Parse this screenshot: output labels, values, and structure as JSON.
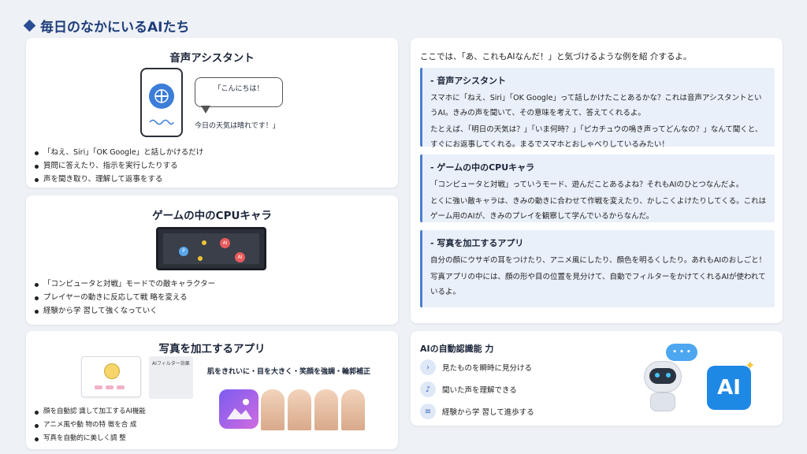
{
  "page": {
    "title": "毎日のなかにいるAIたち"
  },
  "voice_card": {
    "title": "音声アシスタント",
    "bubble_line1": "「こんにちは！",
    "bubble_line2": "今日の天気は晴れです！」",
    "bullets": [
      "「ねえ、Siri」「OK Google」と話しかけるだけ",
      "質問に答えたり、指示を実行したりする",
      "声を聞き取り、理解して返事をする"
    ]
  },
  "game_card": {
    "title": "ゲームの中のCPUキャラ",
    "screen_p": "P",
    "screen_ai1": "AI",
    "screen_ai2": "AI",
    "bullets": [
      "「コンピュータと対戦」モードでの敵キャラクター",
      "プレイヤーの動きに反応して戦 略を変える",
      "経験から学 習して強くなっていく"
    ]
  },
  "photo_card": {
    "title": "写真を加工するアプリ",
    "filter_label": "AIフィルター効果",
    "effect_caption": "肌をきれいに・目を大きく・笑顔を強調・輪郭補正",
    "bullets": [
      "顔を自動認 識して加工するAI機能",
      "アニメ風や動 物の特 徴を合 成",
      "写真を自動的に美しく調 整"
    ]
  },
  "explain": {
    "intro": "ここでは、「あ、これもAIなんだ！」と気づけるような例を紹 介するよ。",
    "sections": [
      {
        "heading": "- 音声アシスタント",
        "paras": [
          "スマホに「ねえ、Siri」「OK Google」って話しかけたことあるかな？これは音声アシスタントというAI。きみの声を聞いて、その意味を考えて、答えてくれるよ。",
          "たとえば、「明日の天気は？」「いま何時？」「ピカチュウの鳴き声ってどんなの？」なんて聞くと、すぐにお返事してくれる。まるでスマホとおしゃべりしているみたい！"
        ]
      },
      {
        "heading": "- ゲームの中のCPUキャラ",
        "paras": [
          "「コンピュータと対戦」っていうモード、遊んだことあるよね？それもAIのひとつなんだよ。",
          "とくに強い敵キャラは、きみの動きに合わせて作戦を変えたり、かしこくよけたりしてくる。これはゲーム用のAIが、きみのプレイを観察して学んでいるからなんだ。"
        ]
      },
      {
        "heading": "- 写真を加工するアプリ",
        "paras": [
          "自分の顔にウサギの耳をつけたり、アニメ風にしたり、顔色を明るくしたり。あれもAIのおしごと！",
          "写真アプリの中には、顔の形や目の位置を見分けて、自動でフィルターをかけてくれるAIが使われているよ。"
        ]
      }
    ]
  },
  "abilities": {
    "title": "AIの自動認識能 力",
    "items": [
      {
        "icon": "chevron-right-icon",
        "glyph": "›",
        "text": "見たものを瞬時に見分ける"
      },
      {
        "icon": "ear-icon",
        "glyph": "♪",
        "text": "聞いた声を理解できる"
      },
      {
        "icon": "document-icon",
        "glyph": "≡",
        "text": "経験から学 習して進歩する"
      }
    ],
    "ai_badge": "AI",
    "speech_dots": "• • •"
  },
  "colors": {
    "accent": "#2a4d95",
    "box_border": "#4a7fd1",
    "box_bg": "#eaf0fa",
    "ai_badge": "#1e88e5"
  }
}
